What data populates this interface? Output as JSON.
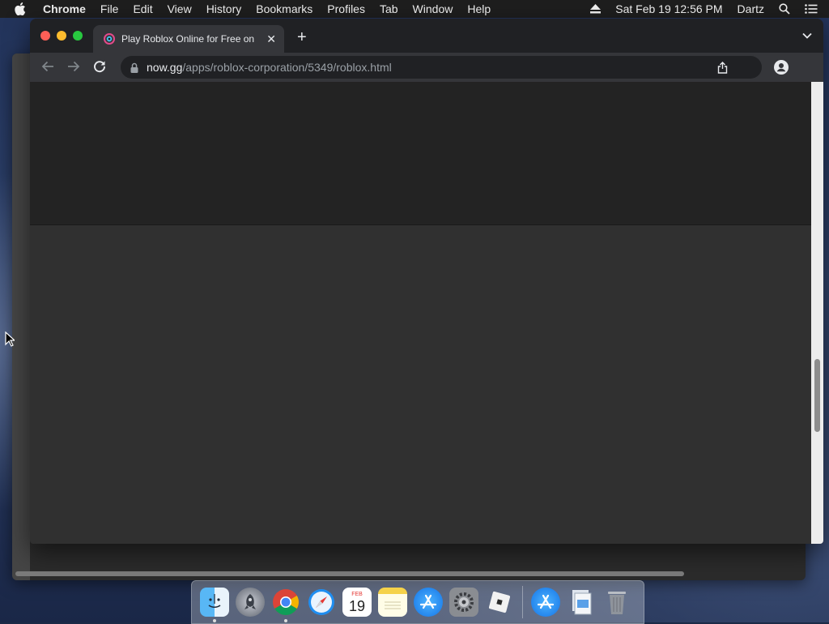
{
  "menubar": {
    "app_name": "Chrome",
    "menus": [
      "File",
      "Edit",
      "View",
      "History",
      "Bookmarks",
      "Profiles",
      "Tab",
      "Window",
      "Help"
    ],
    "clock": "Sat Feb 19  12:56 PM",
    "user": "Dartz"
  },
  "browser": {
    "tab_title": "Play Roblox Online for Free on ",
    "new_tab_symbol": "+",
    "url_host": "now.gg",
    "url_path": "/apps/roblox-corporation/5349/roblox.html"
  },
  "dock": {
    "items": [
      "finder-icon",
      "launchpad-icon",
      "chrome-icon",
      "safari-icon",
      "calendar-icon",
      "notes-icon",
      "app-store-icon",
      "system-preferences-icon",
      "roblox-icon",
      "app-store-download-icon",
      "preview-document-icon",
      "trash-icon"
    ],
    "calendar_month": "FEB",
    "calendar_day": "19"
  },
  "colors": {
    "close": "#ff5f57",
    "minimize": "#febc2e",
    "zoom": "#28c840",
    "chrome_frame": "#202124",
    "toolbar": "#35363a"
  }
}
